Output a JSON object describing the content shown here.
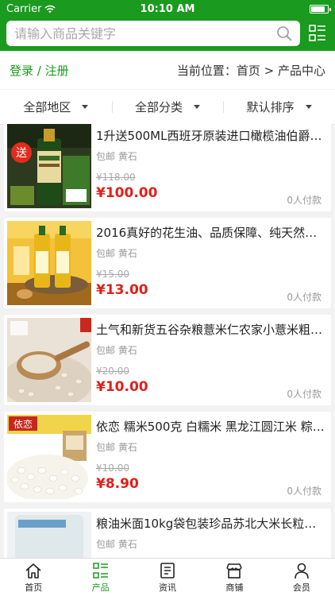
{
  "status_bar": {
    "carrier": "Carrier",
    "time": "10:10 AM",
    "battery_level": 0.9
  },
  "search": {
    "placeholder": "请输入商品关键字"
  },
  "location": {
    "login": "登录",
    "sep": " / ",
    "register": "注册",
    "label": "当前位置：",
    "home": "首页",
    "arrow": " > ",
    "current": "产品中心"
  },
  "filters": [
    {
      "label": "全部地区"
    },
    {
      "label": "全部分类"
    },
    {
      "label": "默认排序"
    }
  ],
  "products": [
    {
      "title": "1升送500ML西班牙原装进口橄榄油伯爵…",
      "shipping": "包邮",
      "seller": "黄石",
      "old_price": "¥118.00",
      "price": "¥100.00",
      "sold": "0人付款",
      "thumb": "olive-oil-bottle",
      "thumb_text": "送"
    },
    {
      "title": "2016真好的花生油、品质保障、纯天然…",
      "shipping": "包邮",
      "seller": "黄石",
      "old_price": "¥15.00",
      "price": "¥13.00",
      "sold": "0人付款",
      "thumb": "peanut-oil-bottles",
      "thumb_text": ""
    },
    {
      "title": "土气和新货五谷杂粮薏米仁农家小薏米粗…",
      "shipping": "包邮",
      "seller": "黄石",
      "old_price": "¥20.00",
      "price": "¥10.00",
      "sold": "0人付款",
      "thumb": "barley-grains",
      "thumb_text": ""
    },
    {
      "title": "依恋 糯米500克 白糯米 黑龙江圆江米 粽…",
      "shipping": "包邮",
      "seller": "黄石",
      "old_price": "¥10.00",
      "price": "¥8.90",
      "sold": "0人付款",
      "thumb": "glutinous-rice",
      "thumb_text": "依恋"
    },
    {
      "title": "粮油米面10kg袋包装珍品苏北大米长粒…",
      "shipping": "包邮",
      "seller": "黄石",
      "old_price": "",
      "price": "",
      "sold": "",
      "thumb": "rice-bag",
      "thumb_text": ""
    }
  ],
  "tabs": [
    {
      "label": "首页",
      "icon": "home-icon"
    },
    {
      "label": "产品",
      "icon": "list-icon",
      "active": true
    },
    {
      "label": "资讯",
      "icon": "news-icon"
    },
    {
      "label": "商铺",
      "icon": "store-icon"
    },
    {
      "label": "会员",
      "icon": "user-icon"
    }
  ],
  "colors": {
    "brand": "#1a9a1e",
    "price": "#e0201b"
  }
}
